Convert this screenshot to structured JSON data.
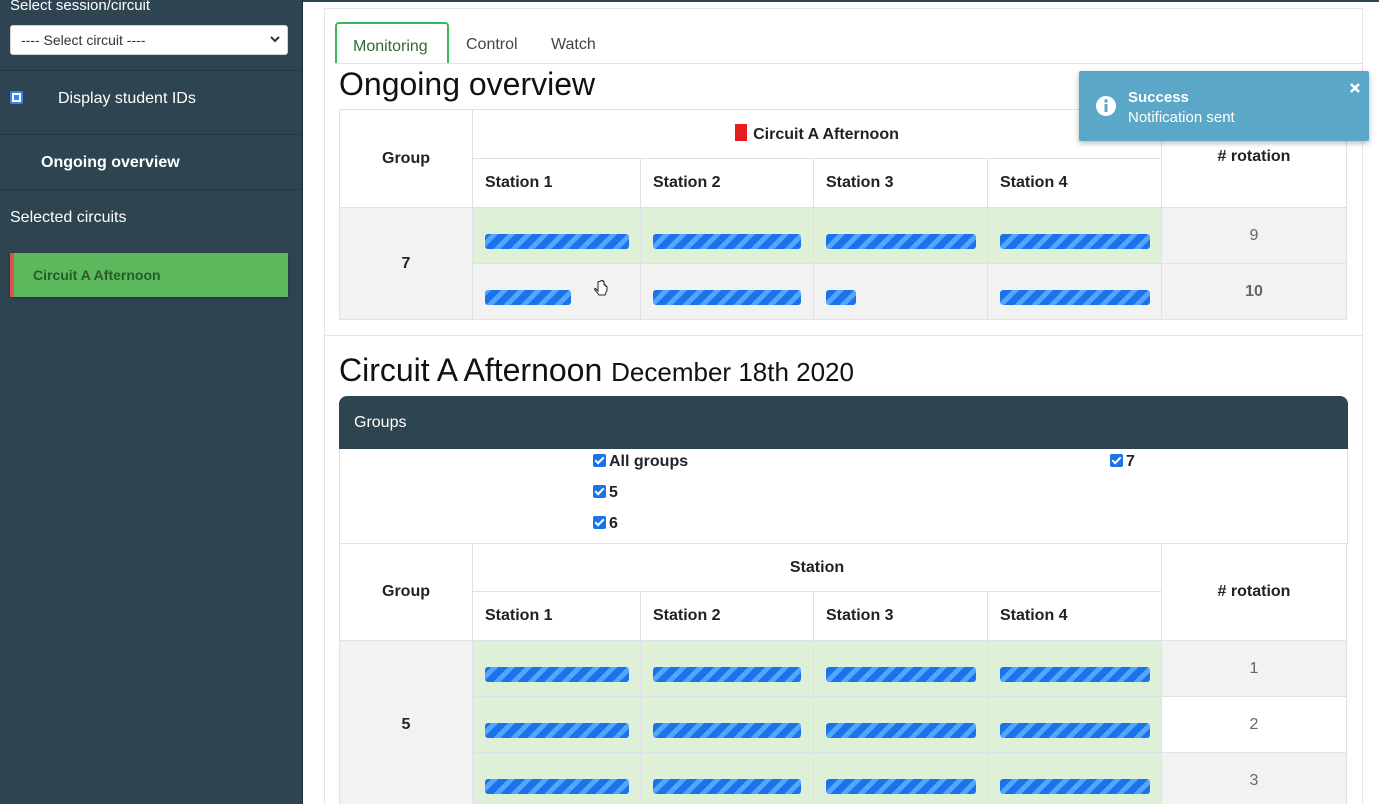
{
  "sidebar": {
    "select_label": "Select session/circuit",
    "select_value": "---- Select circuit ----",
    "display_ids_label": "Display student IDs",
    "ongoing_label": "Ongoing overview",
    "selected_label": "Selected circuits",
    "circuit_item": "Circuit A Afternoon"
  },
  "tabs": [
    "Monitoring",
    "Control",
    "Watch"
  ],
  "overview": {
    "title": "Ongoing overview",
    "group_header": "Group",
    "circuit_header": "Circuit A Afternoon",
    "rotation_header": "# rotation",
    "stations": [
      "Station 1",
      "Station 2",
      "Station 3",
      "Station 4"
    ],
    "group": "7",
    "rows": [
      {
        "rotation": "9",
        "progress": [
          1.0,
          1.0,
          1.0,
          1.0
        ]
      },
      {
        "rotation": "10",
        "progress": [
          0.6,
          1.0,
          0.2,
          1.0
        ]
      }
    ]
  },
  "circuit": {
    "title": "Circuit A Afternoon",
    "date": "December 18th 2020",
    "groups_label": "Groups",
    "group_checks": [
      "All groups",
      "5",
      "6",
      "7"
    ],
    "group_header": "Group",
    "station_header": "Station",
    "rotation_header": "# rotation",
    "stations": [
      "Station 1",
      "Station 2",
      "Station 3",
      "Station 4"
    ],
    "group": "5",
    "rows": [
      {
        "rotation": "1"
      },
      {
        "rotation": "2"
      },
      {
        "rotation": "3"
      }
    ]
  },
  "toast": {
    "title": "Success",
    "message": "Notification sent"
  },
  "colors": {
    "sidebar": "#2e4450",
    "active_circuit": "#5cb85c",
    "toast": "#5aa7c8",
    "progress": "#1a73e8"
  }
}
